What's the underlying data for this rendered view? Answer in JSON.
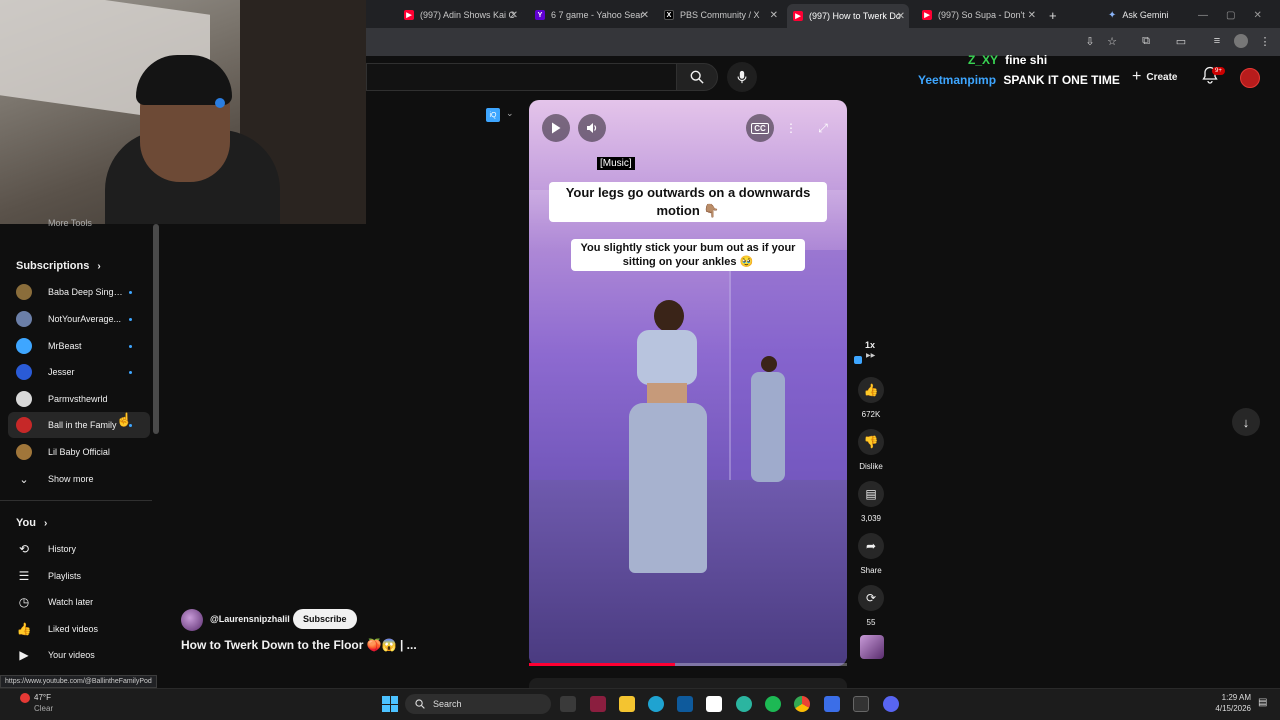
{
  "browser": {
    "tabs": [
      {
        "title": "(997) Adin Shows Kai C",
        "icon": "youtube-icon",
        "color": "#ff0033"
      },
      {
        "title": "6 7 game - Yahoo Sear",
        "icon": "yahoo-icon",
        "color": "#6001d2"
      },
      {
        "title": "PBS Community / X",
        "icon": "x-icon",
        "color": "#000000"
      },
      {
        "title": "(997) How to Twerk Do",
        "icon": "youtube-icon",
        "color": "#ff0033"
      },
      {
        "title": "(997) So Supa - Don't",
        "icon": "youtube-icon",
        "color": "#ff0033"
      }
    ],
    "new_tab": "+",
    "ask_gemini": "Ask Gemini",
    "status_url": "https://www.youtube.com/@BallintheFamilyPod"
  },
  "header": {
    "create_label": "Create",
    "notifications": "9+"
  },
  "chat_overlay": [
    {
      "user": "Z_XY",
      "message": "fine shi",
      "user_color": "#39d353"
    },
    {
      "user": "Yeetmanpimp",
      "message": "SPANK IT ONE TIME",
      "user_color": "#3ea6ff"
    }
  ],
  "sidebar": {
    "more_tools": "More Tools",
    "subscriptions_heading": "Subscriptions",
    "subscriptions": [
      {
        "label": "Baba Deep Singh...",
        "dot": true,
        "color": "#8a6d3b"
      },
      {
        "label": "NotYourAverage...",
        "dot": true,
        "color": "#6b7fa8"
      },
      {
        "label": "MrBeast",
        "dot": true,
        "color": "#3ea6ff"
      },
      {
        "label": "Jesser",
        "dot": true,
        "color": "#2a5bd7"
      },
      {
        "label": "Parmvsthewrld",
        "dot": false,
        "color": "#d8d8d8"
      },
      {
        "label": "Ball in the Family",
        "dot": true,
        "color": "#c62828"
      },
      {
        "label": "Lil Baby Official",
        "dot": false,
        "color": "#a0763a"
      }
    ],
    "show_more": "Show more",
    "you_heading": "You",
    "you_items": [
      {
        "label": "History",
        "icon": "history-icon",
        "glyph": "⟲"
      },
      {
        "label": "Playlists",
        "icon": "playlists-icon",
        "glyph": "☰"
      },
      {
        "label": "Watch later",
        "icon": "watch-later-icon",
        "glyph": "◷"
      },
      {
        "label": "Liked videos",
        "icon": "like-icon",
        "glyph": "👍"
      },
      {
        "label": "Your videos",
        "icon": "your-videos-icon",
        "glyph": "▶"
      }
    ]
  },
  "video": {
    "music_tag": "[Music]",
    "caption_1": "Your legs go outwards on a downwards motion 👇🏽",
    "caption_2": "You slightly stick your bum out as if your sitting on your ankles 🥹",
    "progress": 0.46
  },
  "actions": {
    "speed": "1x",
    "likes": "672K",
    "dislike": "Dislike",
    "comments": "3,039",
    "share": "Share",
    "remix": "55"
  },
  "channel": {
    "handle": "@Laurensnipzhalil",
    "subscribe": "Subscribe",
    "title": "How to Twerk Down to the Floor 🍑😱 | ..."
  },
  "taskbar": {
    "weather_temp": "47°F",
    "weather_desc": "Clear",
    "search": "Search",
    "time": "1:29 AM",
    "date": "4/15/2026"
  }
}
